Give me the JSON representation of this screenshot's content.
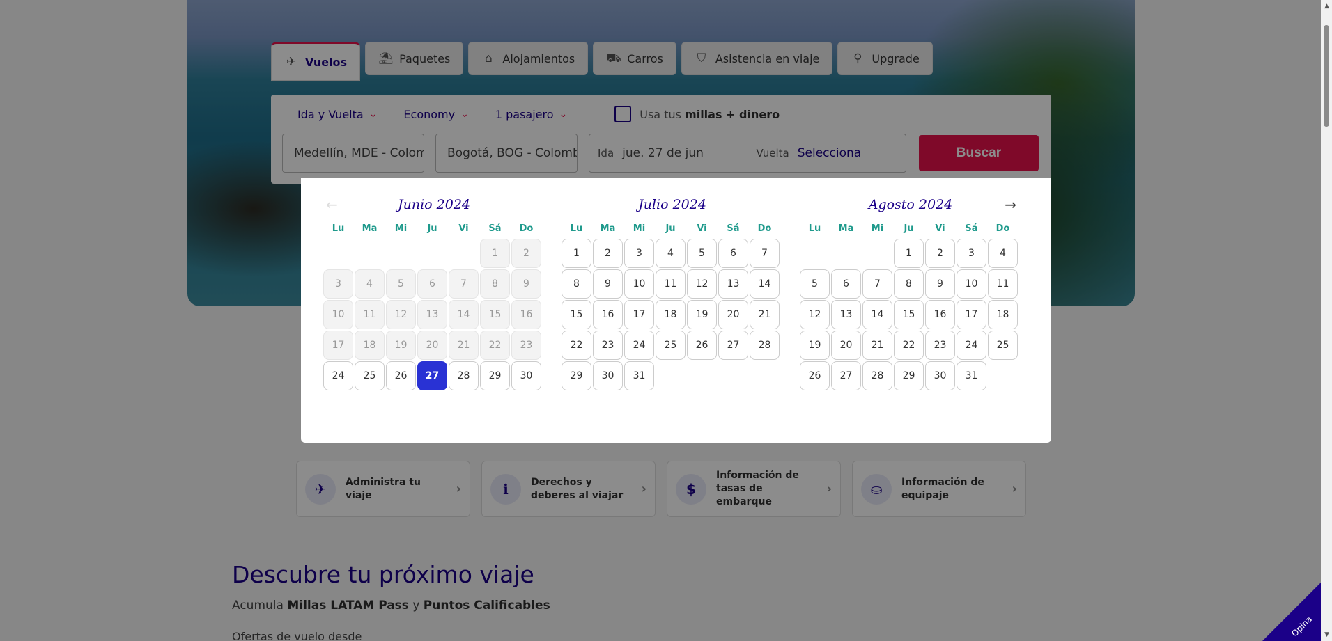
{
  "tabs": [
    {
      "label": "Vuelos",
      "icon": "plane-icon"
    },
    {
      "label": "Paquetes",
      "icon": "package-icon"
    },
    {
      "label": "Alojamientos",
      "icon": "hotel-icon"
    },
    {
      "label": "Carros",
      "icon": "car-icon"
    },
    {
      "label": "Asistencia en viaje",
      "icon": "shield-icon"
    },
    {
      "label": "Upgrade",
      "icon": "upgrade-icon"
    }
  ],
  "search": {
    "trip_type": "Ida y Vuelta",
    "cabin": "Economy",
    "passengers": "1 pasajero",
    "miles_prefix": "Usa tus",
    "miles_bold": "millas + dinero",
    "origin": "Medellín, MDE - Colombia",
    "destination": "Bogotá, BOG - Colombia",
    "ida_label": "Ida",
    "ida_value": "jue. 27 de jun",
    "vuelta_label": "Vuelta",
    "vuelta_value": "Selecciona",
    "search_button": "Buscar"
  },
  "calendar": {
    "weekdays": [
      "Lu",
      "Ma",
      "Mi",
      "Ju",
      "Vi",
      "Sá",
      "Do"
    ],
    "prev_arrow": "←",
    "next_arrow": "→",
    "months": [
      {
        "title": "Junio 2024",
        "offset": 5,
        "days": 30,
        "disabled_until": 23,
        "selected": 27
      },
      {
        "title": "Julio 2024",
        "offset": 0,
        "days": 31,
        "disabled_until": 0,
        "selected": 0
      },
      {
        "title": "Agosto 2024",
        "offset": 3,
        "days": 31,
        "disabled_until": 0,
        "selected": 0
      }
    ]
  },
  "cards": [
    {
      "label": "Administra tu viaje",
      "icon": "plane-icon"
    },
    {
      "label": "Derechos y deberes al viajar",
      "icon": "info-icon"
    },
    {
      "label": "Información de tasas de embarque",
      "icon": "money-icon"
    },
    {
      "label": "Información de equipaje",
      "icon": "luggage-icon"
    }
  ],
  "discover": {
    "title": "Descubre tu próximo viaje",
    "sub_prefix": "Acumula",
    "sub_bold1": "Millas LATAM Pass",
    "sub_mid": "y",
    "sub_bold2": "Puntos Calificables",
    "offers_text": "Ofertas de vuelo desde"
  },
  "feedback": {
    "label": "Opina"
  }
}
